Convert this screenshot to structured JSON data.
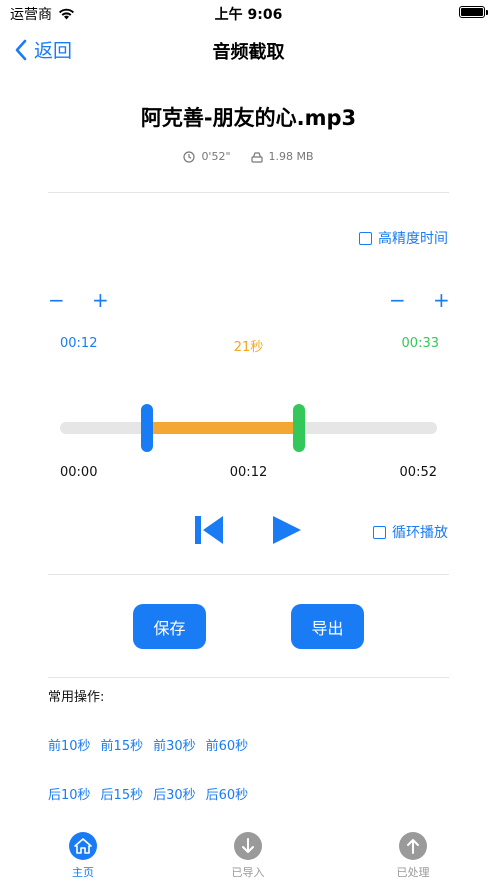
{
  "status_bar": {
    "carrier": "运营商",
    "time": "上午 9:06"
  },
  "nav": {
    "back_label": "返回",
    "title": "音频截取"
  },
  "file": {
    "name": "阿克善-朋友的心.mp3",
    "duration": "0'52\"",
    "size": "1.98 MB"
  },
  "options": {
    "high_precision_label": "高精度时间",
    "loop_label": "循环播放"
  },
  "steppers": {
    "minus": "−",
    "plus": "+"
  },
  "selection": {
    "start": "00:12",
    "length": "21秒",
    "end": "00:33"
  },
  "timeline": {
    "start_label": "00:00",
    "current_label": "00:12",
    "end_label": "00:52",
    "total_seconds": 52,
    "selection_start_seconds": 12,
    "selection_end_seconds": 33
  },
  "actions": {
    "save_label": "保存",
    "export_label": "导出"
  },
  "quick_ops": {
    "title": "常用操作:",
    "front": [
      "前10秒",
      "前15秒",
      "前30秒",
      "前60秒"
    ],
    "back": [
      "后10秒",
      "后15秒",
      "后30秒",
      "后60秒"
    ]
  },
  "tabs": [
    {
      "label": "主页",
      "active": true
    },
    {
      "label": "已导入",
      "active": false
    },
    {
      "label": "已处理",
      "active": false
    }
  ],
  "colors": {
    "accent": "#1a7cf5",
    "selection": "#f5a733",
    "end_handle": "#34c759",
    "inactive": "#9a9a9a"
  }
}
